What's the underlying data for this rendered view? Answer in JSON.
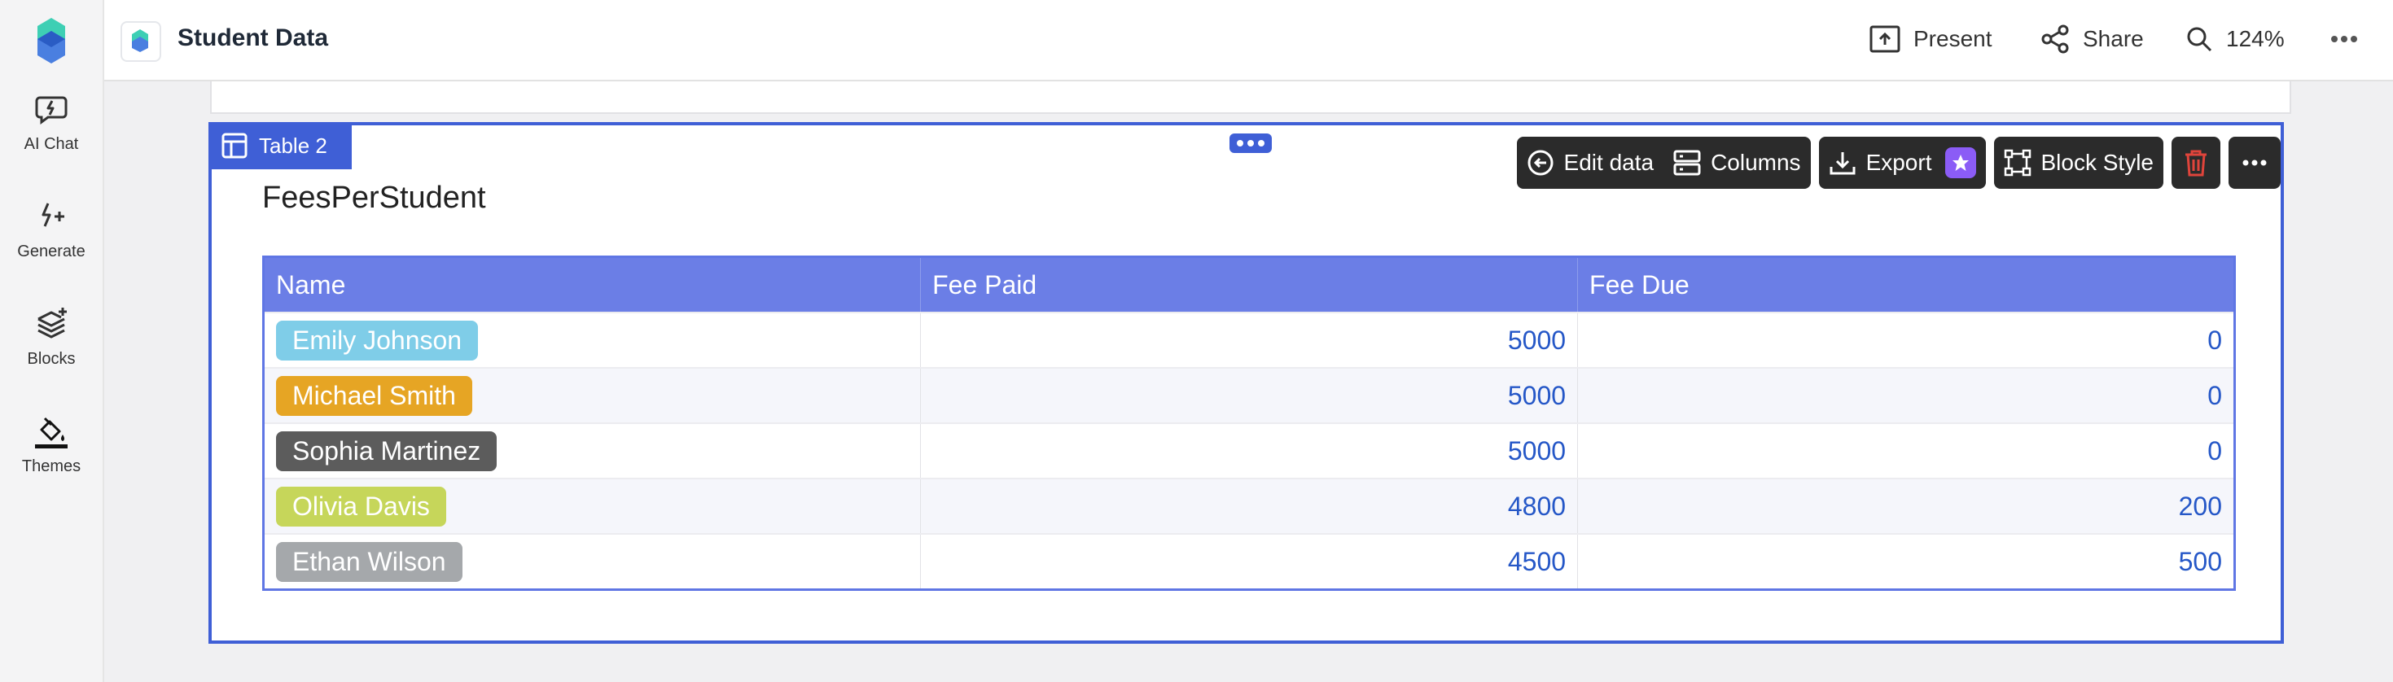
{
  "sidebar": {
    "items": [
      {
        "label": "AI Chat",
        "icon": "chat-spark-icon"
      },
      {
        "label": "Generate",
        "icon": "sparkle-icon"
      },
      {
        "label": "Blocks",
        "icon": "layers-plus-icon"
      },
      {
        "label": "Themes",
        "icon": "paint-bucket-icon"
      }
    ]
  },
  "header": {
    "title": "Student Data",
    "present_label": "Present",
    "share_label": "Share",
    "zoom": "124%"
  },
  "block": {
    "tag_label": "Table 2",
    "title": "FeesPerStudent",
    "toolbar": {
      "edit_data": "Edit data",
      "columns": "Columns",
      "export": "Export",
      "block_style": "Block Style"
    }
  },
  "table": {
    "headers": [
      "Name",
      "Fee Paid",
      "Fee Due"
    ],
    "rows": [
      {
        "name": "Emily Johnson",
        "color": "#7fcde8",
        "paid": "5000",
        "due": "0"
      },
      {
        "name": "Michael Smith",
        "color": "#e6a524",
        "paid": "5000",
        "due": "0"
      },
      {
        "name": "Sophia Martinez",
        "color": "#5c5c5c",
        "paid": "5000",
        "due": "0"
      },
      {
        "name": "Olivia Davis",
        "color": "#c6d65a",
        "paid": "4800",
        "due": "200"
      },
      {
        "name": "Ethan Wilson",
        "color": "#a5a8ab",
        "paid": "4500",
        "due": "500"
      }
    ]
  },
  "colors": {
    "accent": "#3f5fd6",
    "header_row": "#6b7ee6",
    "number_text": "#2557c7",
    "delete_red": "#e0443b",
    "export_star": "#8b5cf6"
  }
}
